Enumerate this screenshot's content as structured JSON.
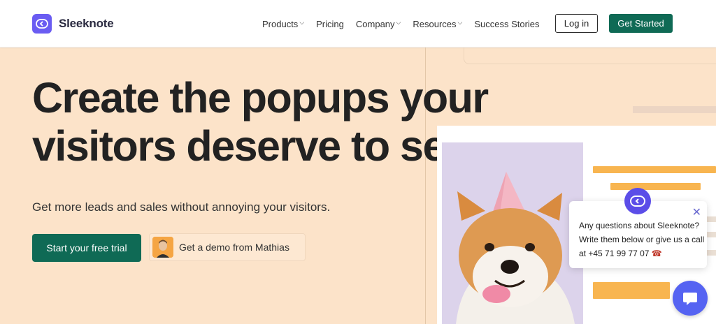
{
  "brand": {
    "name": "Sleeknote",
    "accent": "#6a5cf2",
    "green": "#0f6a55"
  },
  "nav": {
    "items": [
      {
        "label": "Products",
        "has_dropdown": true
      },
      {
        "label": "Pricing",
        "has_dropdown": false
      },
      {
        "label": "Company",
        "has_dropdown": true
      },
      {
        "label": "Resources",
        "has_dropdown": true
      },
      {
        "label": "Success Stories",
        "has_dropdown": false
      }
    ],
    "login_label": "Log in",
    "cta_label": "Get Started"
  },
  "hero": {
    "headline_line1": "Create the popups your",
    "headline_line2": "visitors deserve to see",
    "subheadline": "Get more leads and sales without annoying your visitors.",
    "trial_label": "Start your free trial",
    "demo_label": "Get a demo from Mathias"
  },
  "chat": {
    "message": "Any questions about Sleeknote? Write them below or give us a call at +45 71 99 77 07"
  },
  "icons": {
    "chevron": "chevron-down-icon",
    "close": "close-icon",
    "phone": "phone-icon",
    "chat": "chat-bubble-icon"
  }
}
